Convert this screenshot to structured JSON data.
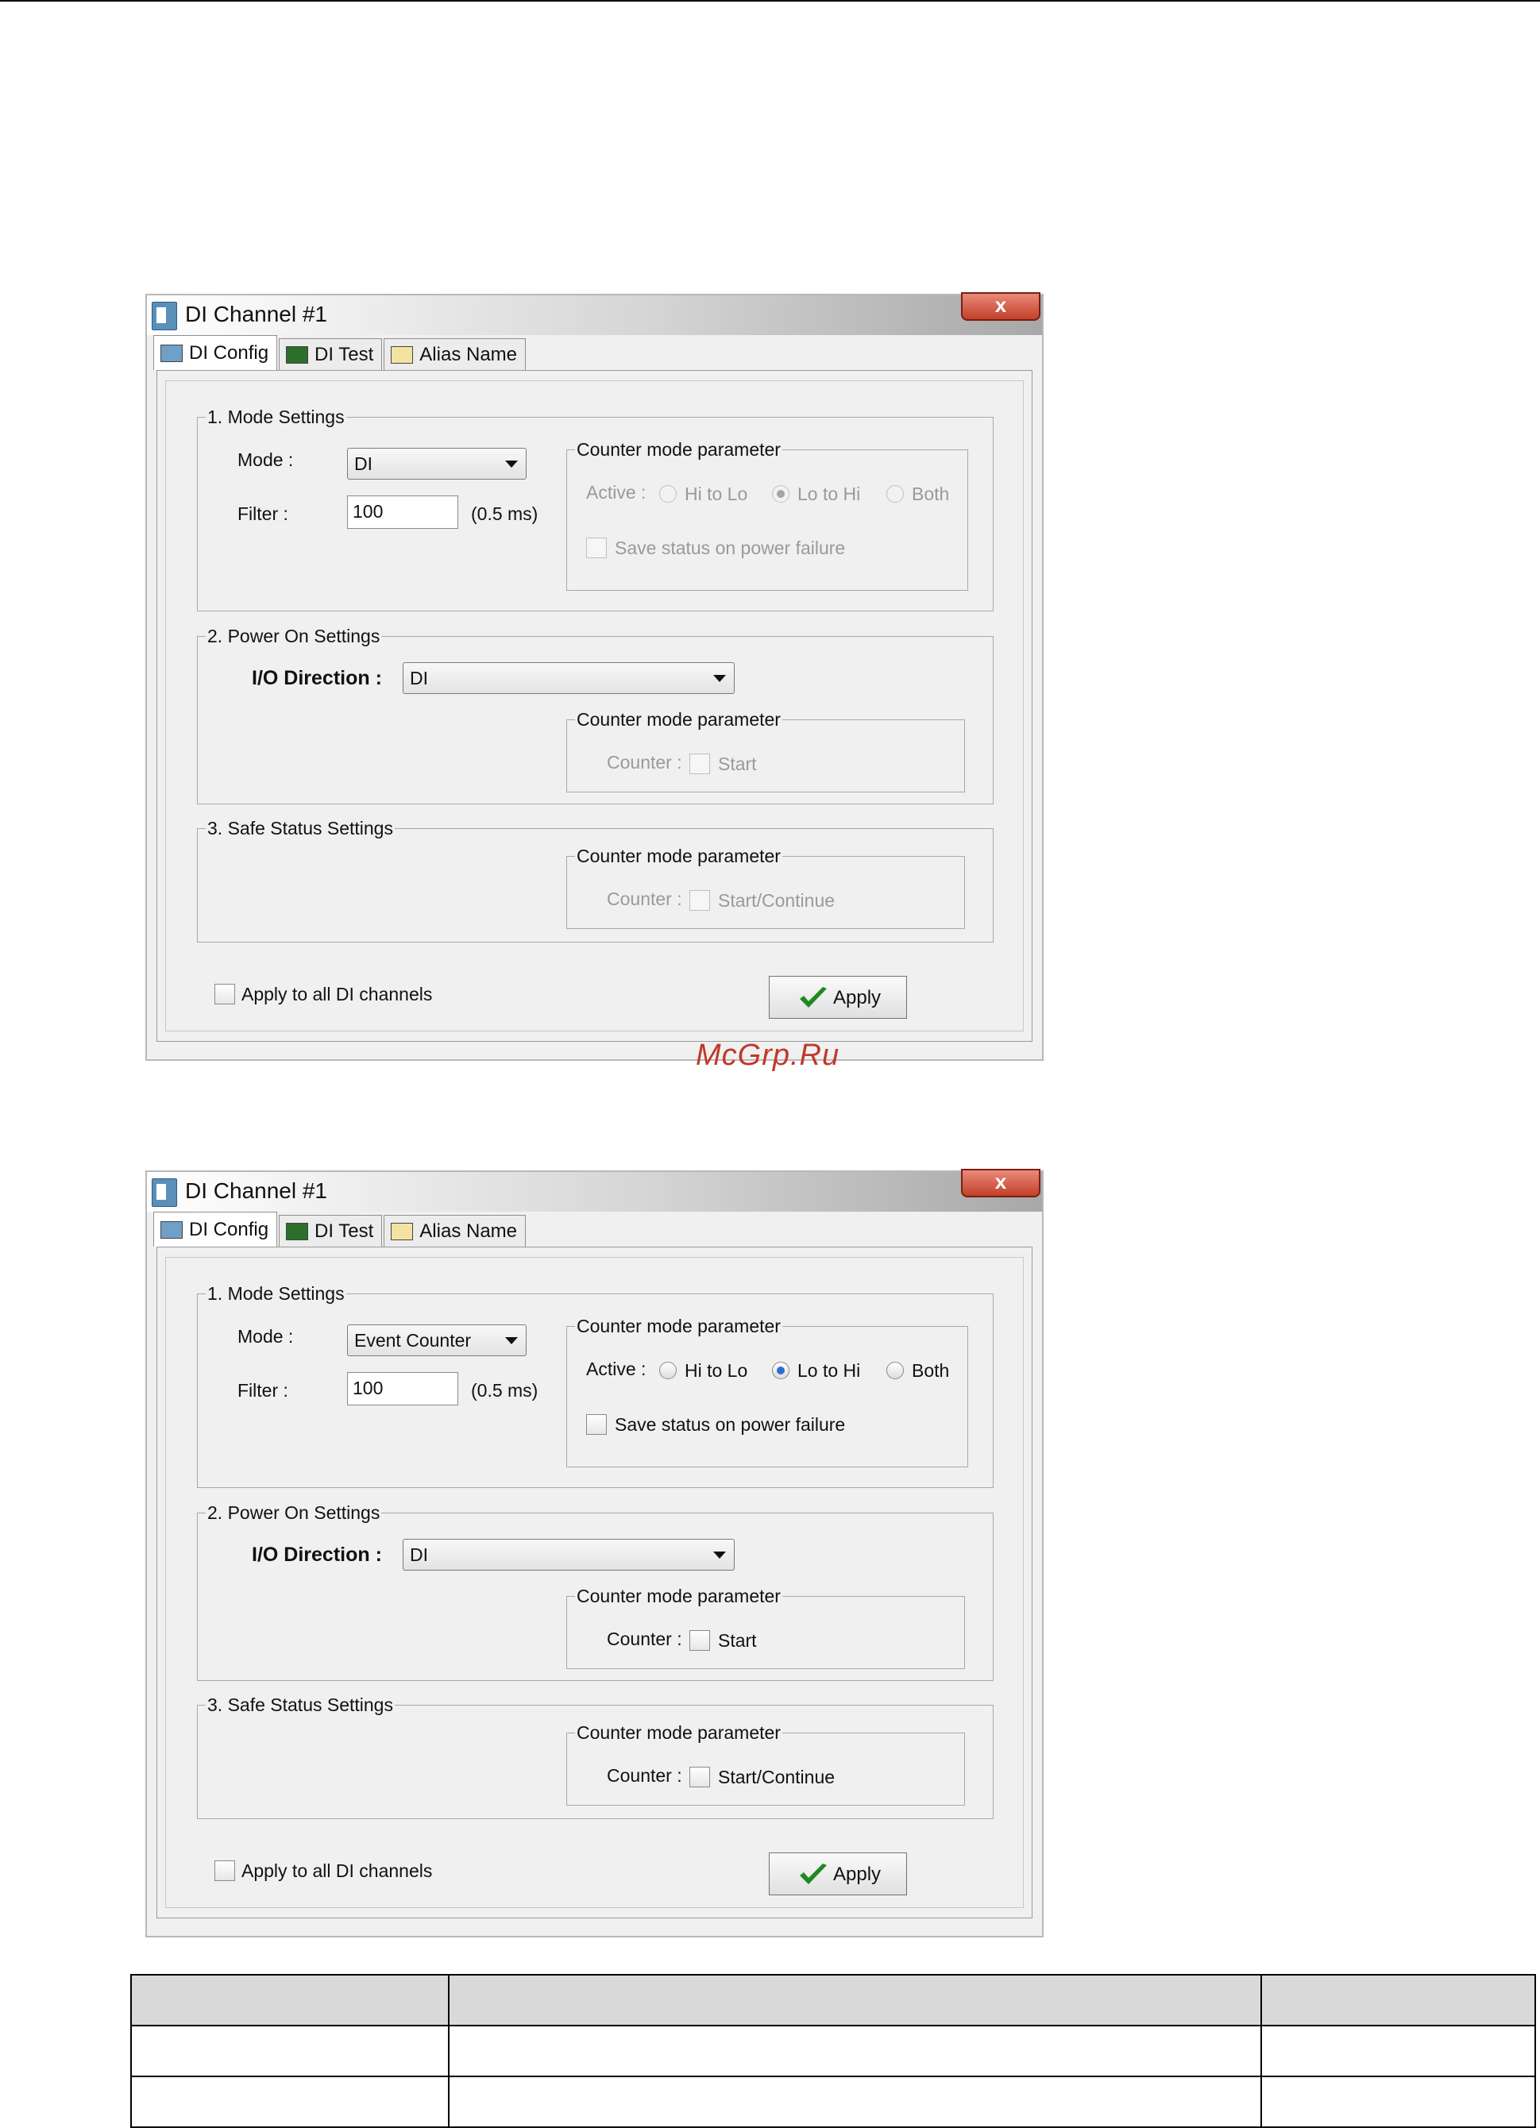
{
  "dialog1": {
    "title": "DI Channel #1",
    "close_label": "x",
    "tabs": [
      {
        "label": "DI Config"
      },
      {
        "label": "DI Test"
      },
      {
        "label": "Alias Name"
      }
    ],
    "mode": {
      "legend": "1. Mode Settings",
      "mode_label": "Mode :",
      "mode_value": "DI",
      "filter_label": "Filter :",
      "filter_value": "100",
      "filter_unit": "(0.5 ms)"
    },
    "counter1": {
      "legend": "Counter mode parameter",
      "active_label": "Active :",
      "hi_to_lo": "Hi to Lo",
      "lo_to_hi": "Lo to Hi",
      "both": "Both",
      "save_status": "Save status on power failure",
      "selected": "Lo to Hi",
      "enabled": false
    },
    "power": {
      "legend": "2. Power On Settings",
      "io_label": "I/O Direction :",
      "io_value": "DI",
      "counter_legend": "Counter mode parameter",
      "counter_label": "Counter :",
      "start_label": "Start"
    },
    "safe": {
      "legend": "3. Safe Status Settings",
      "counter_legend": "Counter mode parameter",
      "counter_label": "Counter :",
      "start_label": "Start/Continue"
    },
    "apply_all": "Apply to all DI channels",
    "apply_button": "Apply"
  },
  "dialog2": {
    "title": "DI Channel #1",
    "close_label": "x",
    "tabs": [
      {
        "label": "DI Config"
      },
      {
        "label": "DI Test"
      },
      {
        "label": "Alias Name"
      }
    ],
    "mode": {
      "legend": "1. Mode Settings",
      "mode_label": "Mode :",
      "mode_value": "Event Counter",
      "filter_label": "Filter :",
      "filter_value": "100",
      "filter_unit": "(0.5 ms)"
    },
    "counter1": {
      "legend": "Counter mode parameter",
      "active_label": "Active :",
      "hi_to_lo": "Hi to Lo",
      "lo_to_hi": "Lo to Hi",
      "both": "Both",
      "save_status": "Save status on power failure",
      "selected": "Lo to Hi",
      "enabled": true
    },
    "power": {
      "legend": "2. Power On Settings",
      "io_label": "I/O Direction :",
      "io_value": "DI",
      "counter_legend": "Counter mode parameter",
      "counter_label": "Counter :",
      "start_label": "Start"
    },
    "safe": {
      "legend": "3. Safe Status Settings",
      "counter_legend": "Counter mode parameter",
      "counter_label": "Counter :",
      "start_label": "Start/Continue"
    },
    "apply_all": "Apply to all DI channels",
    "apply_button": "Apply"
  },
  "watermark": "McGrp.Ru",
  "colors": {
    "accent_check": "#1f8a1f",
    "watermark": "#c0392b",
    "title_close": "#c2402a"
  }
}
